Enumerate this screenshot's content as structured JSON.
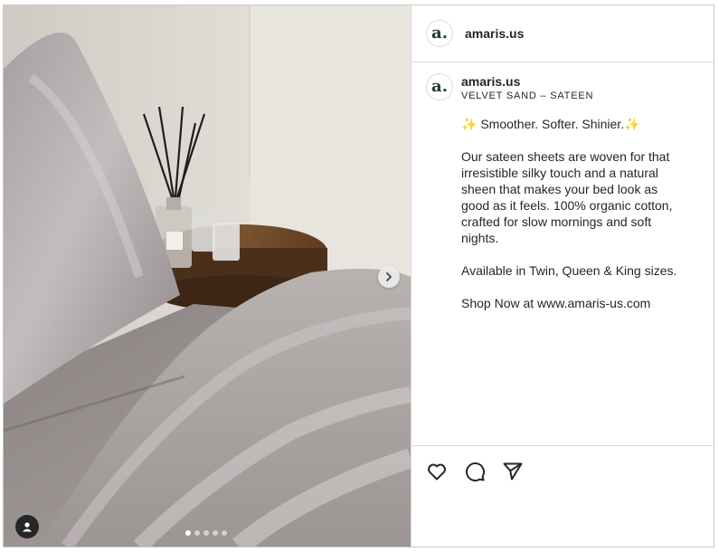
{
  "post": {
    "header_username": "amaris.us",
    "avatar_letter": "a.",
    "author": "amaris.us",
    "subtitle": "VELVET SAND – SATEEN",
    "caption": "✨ Smoother. Softer. Shinier.✨\n\nOur sateen sheets are woven for that irresistible silky touch and a natural sheen that makes your bed look as good as it feels. 100% organic cotton, crafted for slow mornings and soft nights.\n\nAvailable in Twin, Queen & King sizes.\n\nShop Now at www.amaris-us.com"
  },
  "carousel": {
    "total_slides": 5,
    "active_index": 0
  },
  "icons": {
    "next": "chevron-right-icon",
    "tagged_user": "user-icon",
    "like": "heart-icon",
    "comment": "comment-icon",
    "share": "send-icon"
  },
  "colors": {
    "brand_dark_green": "#1f3d2b",
    "border": "#dbdbdb",
    "text": "#262626"
  }
}
